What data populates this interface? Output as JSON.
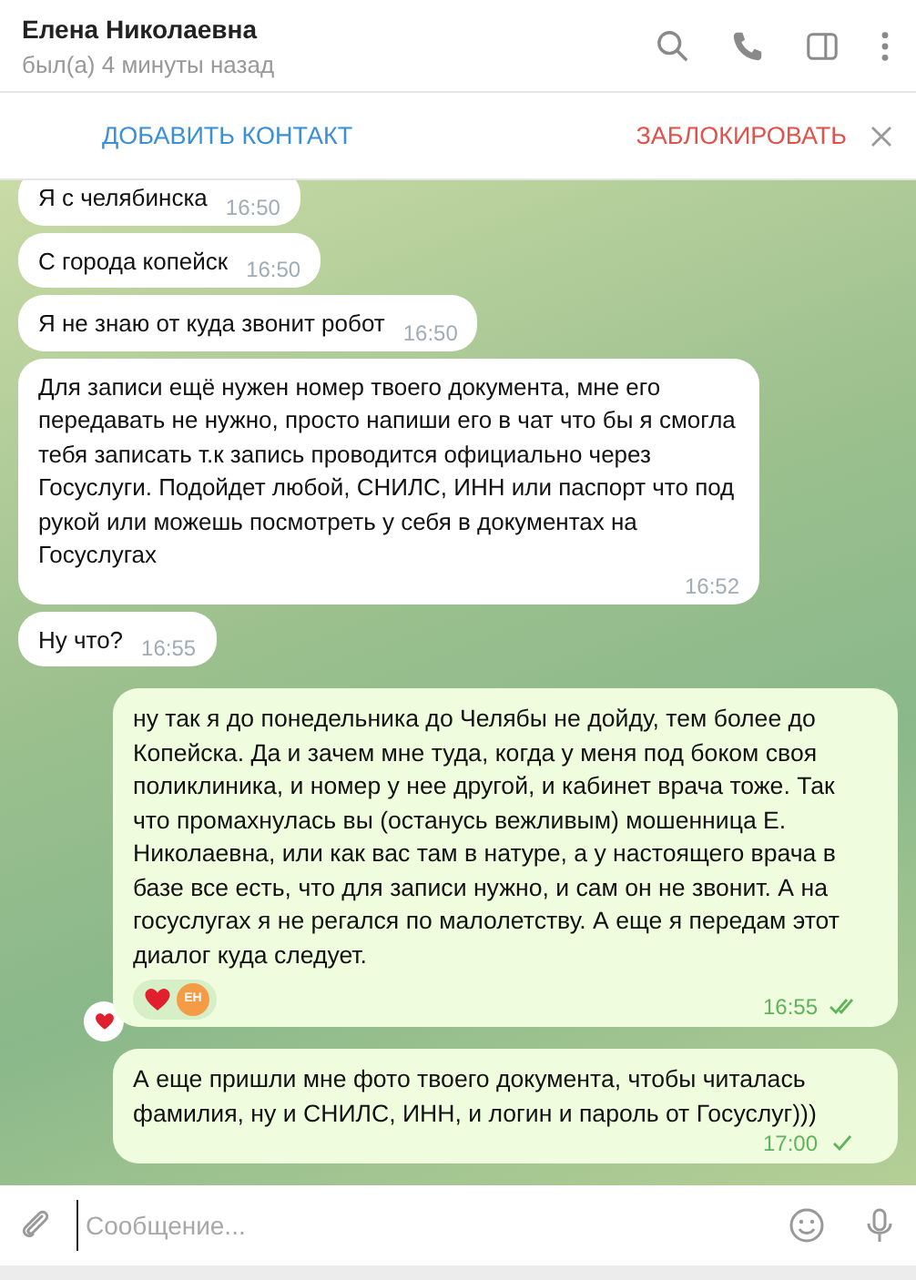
{
  "header": {
    "title": "Елена Николаевна",
    "status": "был(а) 4 минуты назад"
  },
  "action_bar": {
    "add_contact": "ДОБАВИТЬ КОНТАКТ",
    "block": "ЗАБЛОКИРОВАТЬ"
  },
  "messages": [
    {
      "kind": "incoming",
      "text": "Я с челябинска",
      "time": "16:50"
    },
    {
      "kind": "incoming",
      "text": "С города копейск",
      "time": "16:50"
    },
    {
      "kind": "incoming",
      "text": "Я не знаю от куда звонит робот",
      "time": "16:50"
    },
    {
      "kind": "incoming",
      "text": "Для записи ещё нужен номер твоего документа, мне его передавать не нужно, просто напиши его в чат что бы я смогла тебя записать т.к запись проводится официально через Госуслуги. Подойдет любой, СНИЛС, ИНН или паспорт что под рукой или можешь посмотреть у себя в документах на Госуслугах",
      "time": "16:52"
    },
    {
      "kind": "incoming",
      "text": "Ну что?",
      "time": "16:55"
    },
    {
      "kind": "outgoing",
      "text": "ну так я до понедельника до Челябы не дойду, тем более до Копейска. Да и зачем мне туда, когда у меня под боком своя поликлиника, и номер у нее другой, и кабинет врача тоже. Так что промахнулась вы (останусь вежливым) мошенница Е. Николаевна, или как вас там в натуре, а у настоящего врача в базе все есть, что для записи нужно, и сам он не звонит. А на госуслугах я не регался по малолетству. А еще я передам этот диалог куда следует.",
      "time": "16:55",
      "read": true,
      "reaction": {
        "avatar": "ЕН"
      }
    },
    {
      "kind": "outgoing",
      "text": "А еще пришли мне фото твоего документа, чтобы читалась фамилия, ну и СНИЛС, ИНН, и логин и пароль от Госуслуг)))",
      "time": "17:00",
      "read": false
    }
  ],
  "composer": {
    "placeholder": "Сообщение..."
  }
}
